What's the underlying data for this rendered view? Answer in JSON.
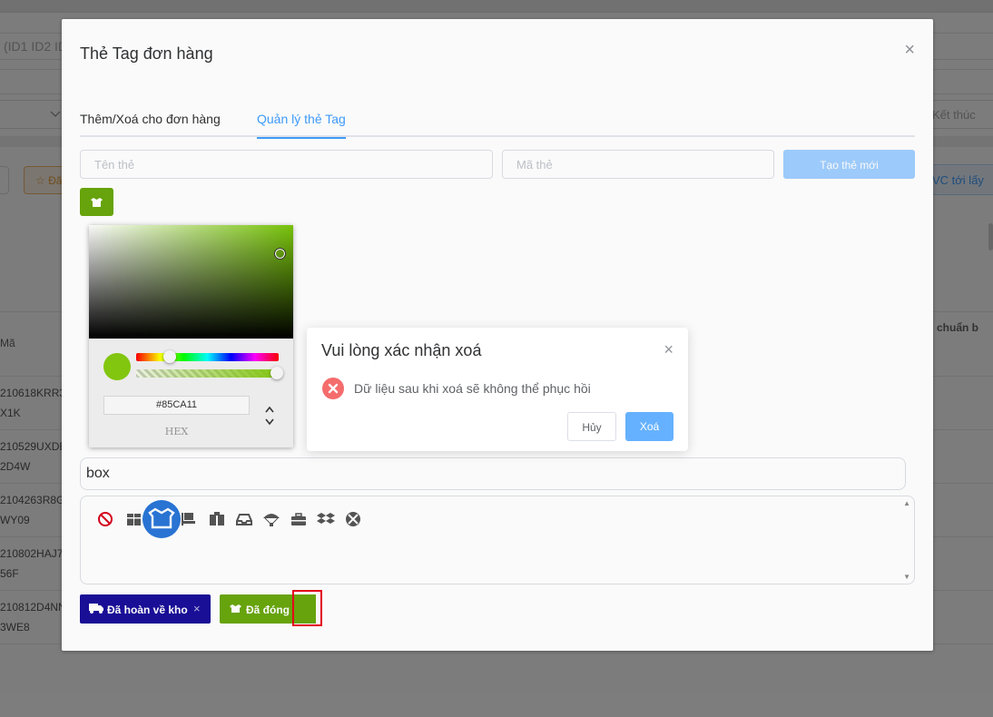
{
  "background": {
    "filter_placeholder": "(ID1 ID2 ID",
    "right_field": "Kết thúc",
    "left_button": "Đã",
    "right_button": "VC tới lấy",
    "table_header_ma": "Mã",
    "table_header_right": "chuẩn b",
    "rows": [
      {
        "l1": "210618KRR3",
        "l2": "X1K"
      },
      {
        "l1": "210529UXDE",
        "l2": "2D4W"
      },
      {
        "l1": "2104263R8G",
        "l2": "WY09"
      },
      {
        "l1": "210802HAJ7",
        "l2": "56F"
      },
      {
        "l1": "210812D4NN",
        "l2": "3WE8"
      }
    ]
  },
  "dialog": {
    "title": "Thẻ Tag đơn hàng",
    "close_glyph": "×",
    "tabs": [
      {
        "label": "Thêm/Xoá cho đơn hàng"
      },
      {
        "label": "Quản lý thẻ Tag"
      }
    ],
    "name_placeholder": "Tên thẻ",
    "code_placeholder": "Mã thẻ",
    "create_button": "Tạo thẻ mới",
    "swatch_color": "#6aa70d",
    "picker": {
      "hex_value": "#85CA11",
      "format_label": "HEX"
    },
    "name_value": "box",
    "icons": [
      "ban-icon",
      "boxes-icon",
      "box-open-icon",
      "dolly-icon",
      "box-tape-icon",
      "inbox-icon",
      "parachute-box-icon",
      "toolbox-icon",
      "dropbox-icon",
      "xbox-icon"
    ],
    "selected_icon": "box-open-icon",
    "tags": [
      {
        "label": "Đã hoàn về kho",
        "color": "#1a0f9a",
        "icon": "truck-icon"
      },
      {
        "label": "Đã đóng",
        "color": "#6aa70d",
        "icon": "box-open-icon"
      }
    ],
    "chip_remove_glyph": "×"
  },
  "confirm": {
    "title": "Vui lòng xác nhận xoá",
    "close_glyph": "×",
    "message": "Dữ liệu sau khi xoá sẽ không thể phục hồi",
    "cancel_label": "Hủy",
    "ok_label": "Xoá",
    "ok_color": "#66b1ff",
    "error_color": "#f56c6c"
  }
}
